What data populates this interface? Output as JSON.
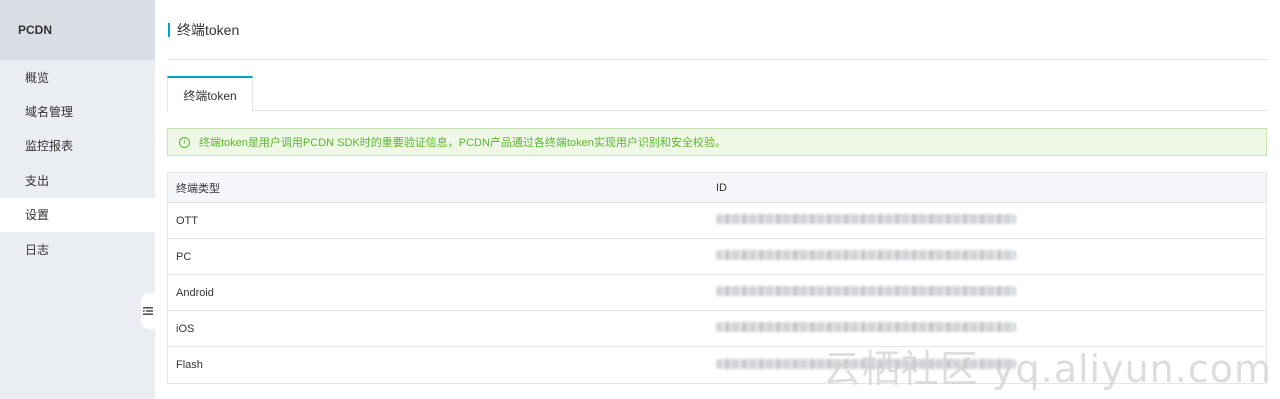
{
  "sidebar": {
    "title": "PCDN",
    "items": [
      {
        "label": "概览"
      },
      {
        "label": "域名管理"
      },
      {
        "label": "监控报表"
      },
      {
        "label": "支出"
      },
      {
        "label": "设置"
      },
      {
        "label": "日志"
      }
    ]
  },
  "page": {
    "title": "终端token"
  },
  "tabs": [
    {
      "label": "终端token"
    }
  ],
  "notice": {
    "icon": "info-icon",
    "text": "终端token是用户调用PCDN SDK时的重要验证信息，PCDN产品通过各终端token实现用户识别和安全校验。"
  },
  "table": {
    "headers": [
      "终端类型",
      "ID"
    ],
    "rows": [
      {
        "type": "OTT"
      },
      {
        "type": "PC"
      },
      {
        "type": "Android"
      },
      {
        "type": "iOS"
      },
      {
        "type": "Flash"
      }
    ]
  },
  "watermark": "云栖社区 yq.aliyun.com",
  "colors": {
    "accent": "#00a2ca",
    "notice_green": "#5cb531",
    "sidebar_bg": "#eaedf1"
  }
}
